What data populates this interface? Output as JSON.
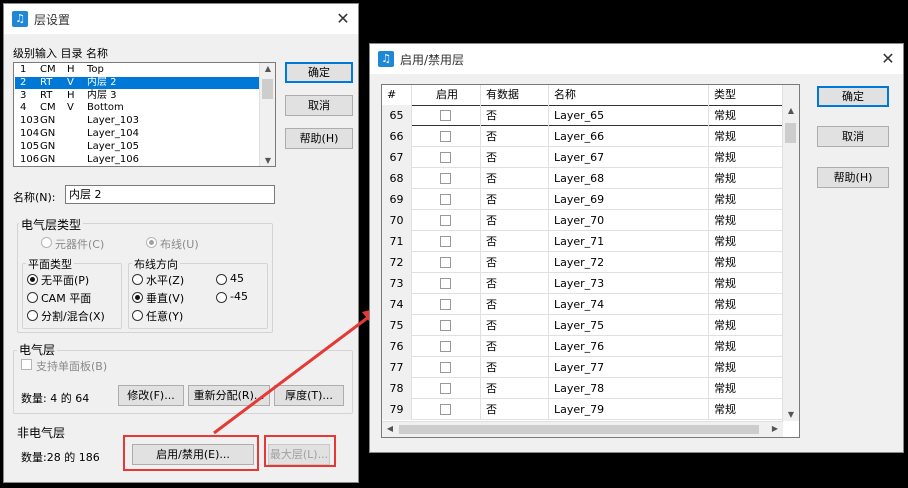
{
  "layer_dialog": {
    "title": "层设置",
    "list_header": "级别输入 目录 名称",
    "layers": [
      {
        "level": "1",
        "dir": "CM",
        "type": "H",
        "name": "Top"
      },
      {
        "level": "2",
        "dir": "RT",
        "type": "V",
        "name": "内层 2",
        "selected": true
      },
      {
        "level": "3",
        "dir": "RT",
        "type": "H",
        "name": "内层 3"
      },
      {
        "level": "4",
        "dir": "CM",
        "type": "V",
        "name": "Bottom"
      },
      {
        "level": "103",
        "dir": "GN",
        "type": "",
        "name": "Layer_103"
      },
      {
        "level": "104",
        "dir": "GN",
        "type": "",
        "name": "Layer_104"
      },
      {
        "level": "105",
        "dir": "GN",
        "type": "",
        "name": "Layer_105"
      },
      {
        "level": "106",
        "dir": "GN",
        "type": "",
        "name": "Layer_106"
      }
    ],
    "buttons": {
      "ok": "确定",
      "cancel": "取消",
      "help": "帮助(H)"
    },
    "name_label": "名称(N):",
    "name_value": "内层 2",
    "electrical_type": {
      "label": "电气层类型",
      "component": "元器件(C)",
      "routing": "布线(U)"
    },
    "plane_type": {
      "label": "平面类型",
      "no_plane": "无平面(P)",
      "cam_plane": "CAM 平面",
      "split_mixed": "分割/混合(X)"
    },
    "routing_dir": {
      "label": "布线方向",
      "horizontal": "水平(Z)",
      "vertical": "垂直(V)",
      "any": "任意(Y)",
      "d45": "45",
      "dm45": "-45"
    },
    "electrical": {
      "label": "电气层",
      "single_sided": "支持单面板(B)",
      "count": "数量: 4 的 64",
      "modify": "修改(F)...",
      "reassign": "重新分配(R)...",
      "thickness": "厚度(T)..."
    },
    "non_electrical": {
      "label": "非电气层",
      "count": "数量:28 的 186",
      "enable_disable": "启用/禁用(E)...",
      "max_layers": "最大层(L)..."
    }
  },
  "enable_dialog": {
    "title": "启用/禁用层",
    "columns": [
      "#",
      "启用",
      "有数据",
      "名称",
      "类型"
    ],
    "rows": [
      {
        "num": "65",
        "has_data": "否",
        "name": "Layer_65",
        "type": "常规"
      },
      {
        "num": "66",
        "has_data": "否",
        "name": "Layer_66",
        "type": "常规"
      },
      {
        "num": "67",
        "has_data": "否",
        "name": "Layer_67",
        "type": "常规"
      },
      {
        "num": "68",
        "has_data": "否",
        "name": "Layer_68",
        "type": "常规"
      },
      {
        "num": "69",
        "has_data": "否",
        "name": "Layer_69",
        "type": "常规"
      },
      {
        "num": "70",
        "has_data": "否",
        "name": "Layer_70",
        "type": "常规"
      },
      {
        "num": "71",
        "has_data": "否",
        "name": "Layer_71",
        "type": "常规"
      },
      {
        "num": "72",
        "has_data": "否",
        "name": "Layer_72",
        "type": "常规"
      },
      {
        "num": "73",
        "has_data": "否",
        "name": "Layer_73",
        "type": "常规"
      },
      {
        "num": "74",
        "has_data": "否",
        "name": "Layer_74",
        "type": "常规"
      },
      {
        "num": "75",
        "has_data": "否",
        "name": "Layer_75",
        "type": "常规"
      },
      {
        "num": "76",
        "has_data": "否",
        "name": "Layer_76",
        "type": "常规"
      },
      {
        "num": "77",
        "has_data": "否",
        "name": "Layer_77",
        "type": "常规"
      },
      {
        "num": "78",
        "has_data": "否",
        "name": "Layer_78",
        "type": "常规"
      },
      {
        "num": "79",
        "has_data": "否",
        "name": "Layer_79",
        "type": "常规"
      }
    ],
    "buttons": {
      "ok": "确定",
      "cancel": "取消",
      "help": "帮助(H)"
    }
  },
  "colors": {
    "accent": "#0078d7",
    "highlight": "#e53935"
  }
}
